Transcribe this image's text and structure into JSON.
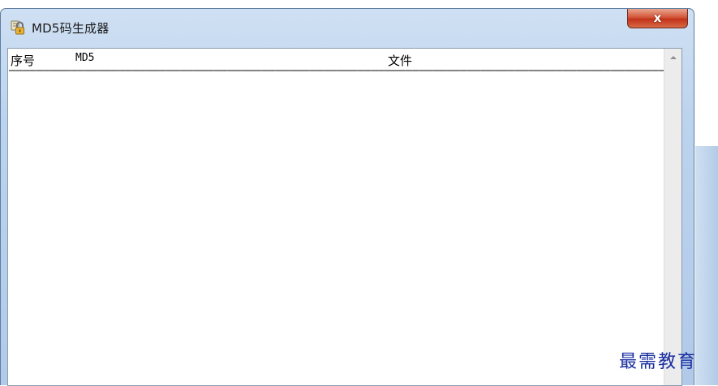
{
  "window": {
    "title": "MD5码生成器",
    "close_label": "x"
  },
  "list": {
    "columns": [
      "序号",
      "MD5",
      "文件"
    ],
    "separator": "————————————————————————————————————————————————————————————————————————————————————————————————————————————————————————————————————————————————————————————————————————————————"
  },
  "watermark": "最需教育",
  "icons": {
    "app": "lock-icon",
    "close": "close-icon",
    "scroll_up": "scroll-up-arrow-icon"
  },
  "colors": {
    "titlebar": "#bcd3ee",
    "close_button": "#c2331a",
    "watermark": "#1a2fa0"
  }
}
